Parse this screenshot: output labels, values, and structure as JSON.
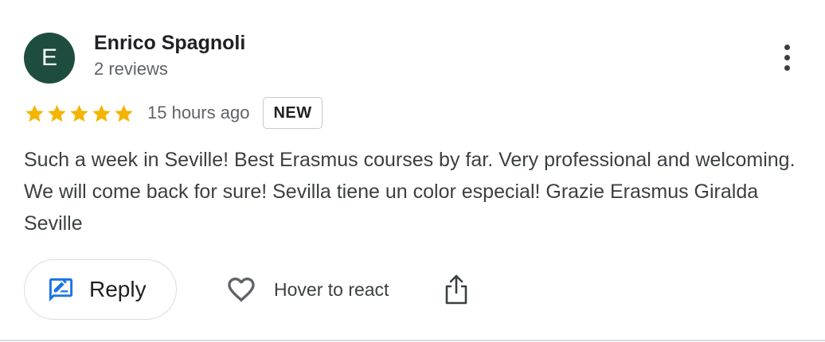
{
  "review": {
    "author": {
      "initial": "E",
      "name": "Enrico Spagnoli",
      "reviews_count": "2 reviews",
      "avatar_color": "#1e4d3f"
    },
    "rating": 5,
    "max_rating": 5,
    "star_color": "#f4b400",
    "time_ago": "15 hours ago",
    "badge": "NEW",
    "text": "Such a week in Seville! Best Erasmus courses by far. Very professional and welcoming. We will come back for sure! Sevilla tiene un color especial! Grazie Erasmus Giralda Seville"
  },
  "actions": {
    "more_icon": "more-vert-icon",
    "reply_icon": "reply-edit-icon",
    "reply_label": "Reply",
    "react_icon": "heart-outline-icon",
    "react_label": "Hover to react",
    "share_icon": "share-icon",
    "accent_color": "#1a73e8"
  }
}
